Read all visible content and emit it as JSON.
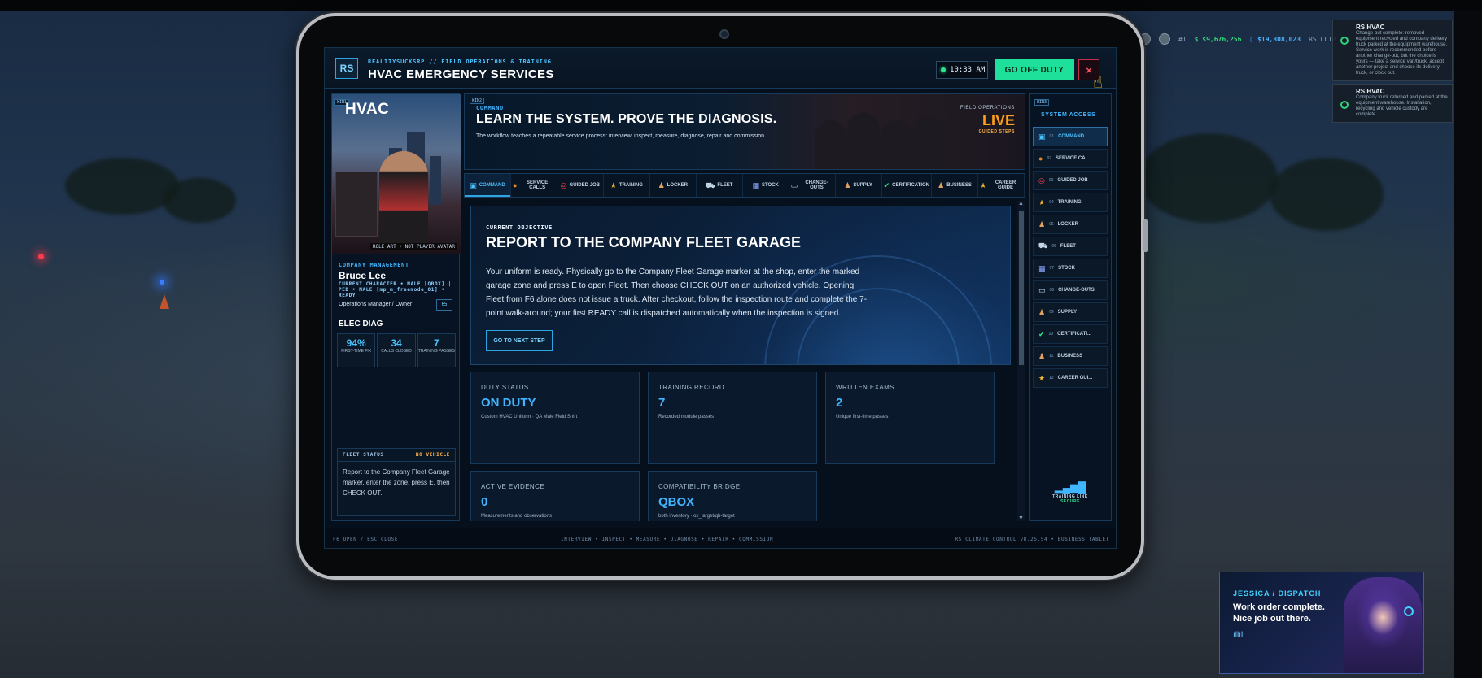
{
  "hud": {
    "id_badge": "#1",
    "cash": "$ $9,676,256",
    "bank": "▯ $19,808,023",
    "server": "RS CLIM"
  },
  "notifications": [
    {
      "title": "RS HVAC",
      "body": "Change-out complete: removed equipment recycled and company delivery truck parked at the equipment warehouse. Service work is recommended before another change-out, but the choice is yours — take a service van/truck, accept another project and choose its delivery truck, or clock out."
    },
    {
      "title": "RS HVAC",
      "body": "Company truck returned and parked at the equipment warehouse. Installation, recycling and vehicle custody are complete."
    }
  ],
  "tablet": {
    "logo": "RS",
    "subtitle": "REALITYSUCKSRP // FIELD OPERATIONS & TRAINING",
    "title": "HVAC EMERGENCY SERVICES",
    "clock": "10:33 AM",
    "off_duty": "GO OFF DUTY",
    "close": "×"
  },
  "profile": {
    "tag": "WIN1",
    "brand": "HVAC",
    "caption": "ROLE ART • NOT PLAYER AVATAR",
    "section": "COMPANY MANAGEMENT",
    "name": "Bruce Lee",
    "character": "CURRENT CHARACTER • MALE [QBOX] | PED • MALE [mp_m_freemode_01] • READY",
    "role": "Operations Manager / Owner",
    "badge": "65",
    "skill": "ELEC DIAG",
    "stats": [
      {
        "value": "94%",
        "label": "FIRST-TIME FIX"
      },
      {
        "value": "34",
        "label": "CALLS CLOSED"
      },
      {
        "value": "7",
        "label": "TRAINING PASSES"
      }
    ],
    "fleet_title": "FLEET STATUS",
    "fleet_status": "NO VEHICLE",
    "fleet_text": "Report to the Company Fleet Garage marker, enter the zone, press E, then CHECK OUT."
  },
  "hero": {
    "tag": "WIN2",
    "section": "COMMAND",
    "headline": "LEARN THE SYSTEM. PROVE THE DIAGNOSIS.",
    "desc": "The workflow teaches a repeatable service process: interview, inspect, measure, diagnose, repair and commission.",
    "field_ops": "FIELD OPERATIONS",
    "live": "LIVE",
    "guided": "GUIDED STEPS"
  },
  "tabs": [
    {
      "label": "COMMAND",
      "icon": "▣"
    },
    {
      "label": "SERVICE CALLS",
      "icon": "●"
    },
    {
      "label": "GUIDED JOB",
      "icon": "◎"
    },
    {
      "label": "TRAINING",
      "icon": "★"
    },
    {
      "label": "LOCKER",
      "icon": "♟"
    },
    {
      "label": "FLEET",
      "icon": "⛟"
    },
    {
      "label": "STOCK",
      "icon": "▦"
    },
    {
      "label": "CHANGE-OUTS",
      "icon": "▭"
    },
    {
      "label": "SUPPLY",
      "icon": "♟"
    },
    {
      "label": "CERTIFICATION",
      "icon": "✔"
    },
    {
      "label": "BUSINESS",
      "icon": "♟"
    },
    {
      "label": "CAREER GUIDE",
      "icon": "★"
    }
  ],
  "objective": {
    "kicker": "CURRENT OBJECTIVE",
    "title": "REPORT TO THE COMPANY FLEET GARAGE",
    "text": "Your uniform is ready. Physically go to the Company Fleet Garage marker at the shop, enter the marked garage zone and press E to open Fleet. Then choose CHECK OUT on an authorized vehicle. Opening Fleet from F6 alone does not issue a truck. After checkout, follow the inspection route and complete the 7-point walk-around; your first READY call is dispatched automatically when the inspection is signed.",
    "button": "GO TO NEXT STEP"
  },
  "cards": [
    {
      "label": "DUTY STATUS",
      "value": "ON DUTY",
      "sub": "Custom HVAC Uniform · QA Male Field Shirt"
    },
    {
      "label": "TRAINING RECORD",
      "value": "7",
      "sub": "Recorded module passes"
    },
    {
      "label": "WRITTEN EXAMS",
      "value": "2",
      "sub": "Unique first-time passes"
    },
    {
      "label": "ACTIVE EVIDENCE",
      "value": "0",
      "sub": "Measurements and observations"
    },
    {
      "label": "COMPATIBILITY BRIDGE",
      "value": "QBOX",
      "sub": "both inventory · ox_target/qb-target"
    }
  ],
  "system": {
    "tag": "WIN3",
    "title": "SYSTEM ACCESS",
    "items": [
      {
        "num": "01",
        "label": "COMMAND",
        "icon": "▣"
      },
      {
        "num": "02",
        "label": "SERVICE CAL...",
        "icon": "●"
      },
      {
        "num": "03",
        "label": "GUIDED JOB",
        "icon": "◎"
      },
      {
        "num": "04",
        "label": "TRAINING",
        "icon": "★"
      },
      {
        "num": "05",
        "label": "LOCKER",
        "icon": "♟"
      },
      {
        "num": "06",
        "label": "FLEET",
        "icon": "⛟"
      },
      {
        "num": "07",
        "label": "STOCK",
        "icon": "▦"
      },
      {
        "num": "08",
        "label": "CHANGE-OUTS",
        "icon": "▭"
      },
      {
        "num": "09",
        "label": "SUPPLY",
        "icon": "♟"
      },
      {
        "num": "10",
        "label": "CERTIFICATI...",
        "icon": "✔"
      },
      {
        "num": "11",
        "label": "BUSINESS",
        "icon": "♟"
      },
      {
        "num": "12",
        "label": "CAREER GUI...",
        "icon": "★"
      }
    ],
    "link_bars": "▂▄▆█",
    "link_title": "TRAINING LINK",
    "link_status": "SECURE"
  },
  "footer": {
    "left": "F6 OPEN / ESC CLOSE",
    "center": "INTERVIEW • INSPECT • MEASURE • DIAGNOSE • REPAIR • COMMISSION",
    "right": "RS CLIMATE CONTROL v8.25.54 • BUSINESS TABLET"
  },
  "dispatch": {
    "title": "JESSICA / DISPATCH",
    "message": "Work order complete. Nice job out there.",
    "bars": "ıllıl"
  },
  "colors": {
    "accent": "#2ea4e0",
    "go_off_duty": "#1fe09a",
    "live": "#ff9f1c",
    "close": "#ff5366"
  }
}
